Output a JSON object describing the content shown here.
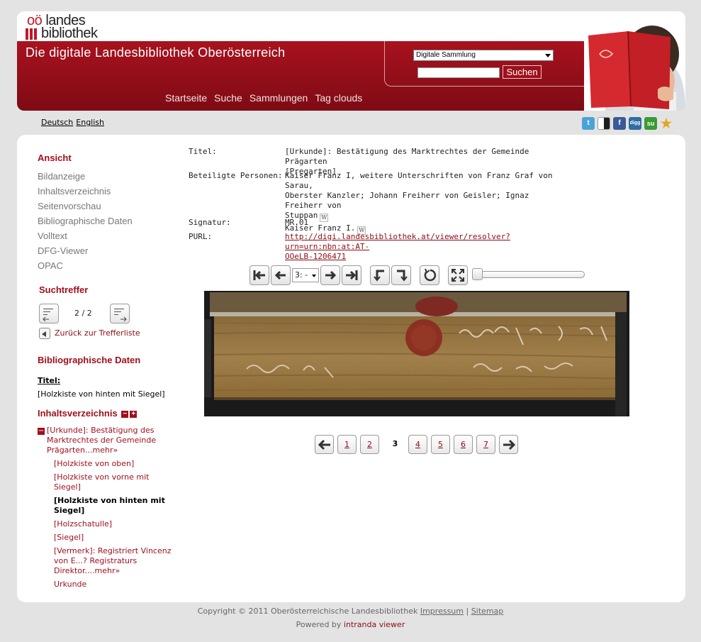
{
  "logo": {
    "line1_prefix": "oö",
    "line1": "landes",
    "line2": "bibliothek"
  },
  "header": {
    "site_title": "Die digitale Landesbibliothek Oberösterreich",
    "collection_select": "Digitale Sammlung",
    "search_placeholder": "",
    "search_button": "Suchen",
    "nav": [
      "Startseite",
      "Suche",
      "Sammlungen",
      "Tag clouds"
    ]
  },
  "languages": [
    "Deutsch",
    "English"
  ],
  "social": [
    {
      "name": "twitter",
      "glyph": "t",
      "color": "#4aa3d8"
    },
    {
      "name": "delicious",
      "glyph": "",
      "color": "#1e1e1e"
    },
    {
      "name": "facebook",
      "glyph": "f",
      "color": "#3b5998"
    },
    {
      "name": "digg",
      "glyph": "digg",
      "color": "#2d6da3"
    },
    {
      "name": "stumbleupon",
      "glyph": "su",
      "color": "#3a9a35"
    },
    {
      "name": "favorite",
      "glyph": "★",
      "color": "#e3a521"
    }
  ],
  "sidebar": {
    "view_heading": "Ansicht",
    "view_links": [
      "Bildanzeige",
      "Inhaltsverzeichnis",
      "Seitenvorschau",
      "Bibliographische Daten",
      "Volltext",
      "DFG-Viewer",
      "OPAC"
    ],
    "hits_heading": "Suchtreffer",
    "hit_count": "2 / 2",
    "back_link": "Zurück zur Trefferliste",
    "biblio_heading": "Bibliographische Daten",
    "title_label": "Titel:",
    "title_value": "[Holzkiste von hinten mit Siegel]",
    "toc_heading": "Inhaltsverzeichnis",
    "toc_root": [
      "[Urkunde]: Bestätigung des",
      "Marktrechtes der Gemeinde",
      "Prägarten...mehr»"
    ],
    "toc_items": [
      {
        "lines": [
          "[Holzkiste von oben]"
        ],
        "current": false
      },
      {
        "lines": [
          "[Holzkiste von vorne mit",
          "Siegel]"
        ],
        "current": false
      },
      {
        "lines": [
          "[Holzkiste von hinten mit",
          "Siegel]"
        ],
        "current": true
      },
      {
        "lines": [
          "[Holzschatulle]"
        ],
        "current": false
      },
      {
        "lines": [
          "[Siegel]"
        ],
        "current": false
      },
      {
        "lines": [
          "[Vermerk]: Registriert Vincenz",
          "von E...? Registraturs",
          "Direktor....mehr»"
        ],
        "current": false
      },
      {
        "lines": [
          "Urkunde"
        ],
        "current": false
      }
    ]
  },
  "metadata": {
    "title_label": "Titel:",
    "title_value": [
      "[Urkunde]: Bestätigung des Marktrechtes der Gemeinde Prägarten",
      "[Pregarten]"
    ],
    "persons_label": "Beteiligte Personen:",
    "persons_value": [
      "Kaiser Franz I, weitere Unterschriften von Franz Graf von Sarau,",
      "Oberster Kanzler; Johann Freiherr von Geisler; Ignaz Freiherr von",
      "Stuppan"
    ],
    "persons_value2": "Kaiser Franz I.",
    "wiki_glyph": "W",
    "signature_label": "Signatur:",
    "signature_value": "MR.01",
    "purl_label": "PURL:",
    "purl_value": [
      "http://digi.landesbibliothek.at/viewer/resolver?urn=urn:nbn:at:AT-",
      "OOeLB-1206471"
    ]
  },
  "viewer": {
    "page_select": "3: -",
    "zoom_level": 0
  },
  "pagination": {
    "pages": [
      "1",
      "2",
      "3",
      "4",
      "5",
      "6",
      "7"
    ],
    "current": "3"
  },
  "footer": {
    "copyright": "Copyright © 2011 Oberösterreichische Landesbibliothek",
    "impressum": "Impressum",
    "separator": "|",
    "sitemap": "Sitemap",
    "powered_by": "Powered by",
    "powered_link": "intranda viewer"
  }
}
